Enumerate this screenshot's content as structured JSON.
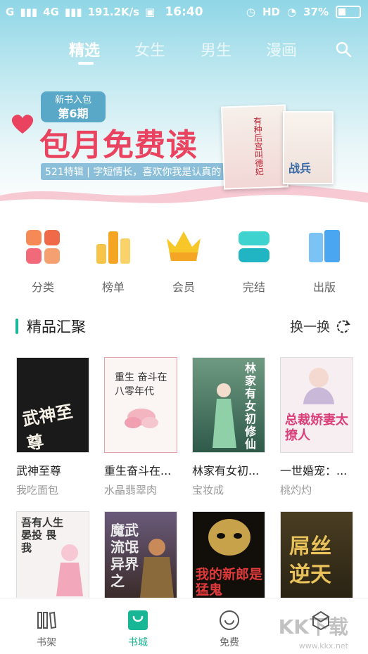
{
  "status_bar": {
    "signal_1": "G",
    "signal_2": "4G",
    "speed": "191.2K/s",
    "time": "16:40",
    "network": "HD",
    "battery": "37%"
  },
  "tabs": [
    {
      "label": "精选",
      "active": true
    },
    {
      "label": "女生",
      "active": false
    },
    {
      "label": "男生",
      "active": false
    },
    {
      "label": "漫画",
      "active": false
    }
  ],
  "banner": {
    "tag_line1": "新书入包",
    "tag_line2": "第6期",
    "title": "包月免费读",
    "subtitle": "521特辑 | 字短情长，喜欢你我是认真的",
    "book_a_text": "有种后宫叫德妃",
    "book_b_text": "战兵"
  },
  "categories": [
    {
      "label": "分类",
      "icon": "grid-icon",
      "color": "#f06a4a"
    },
    {
      "label": "榜单",
      "icon": "bar-chart-icon",
      "color": "#f5b12c"
    },
    {
      "label": "会员",
      "icon": "crown-icon",
      "color": "#f7c72a"
    },
    {
      "label": "完结",
      "icon": "stack-icon",
      "color": "#2dc6c4"
    },
    {
      "label": "出版",
      "icon": "book-icon",
      "color": "#4aa6f0"
    }
  ],
  "section": {
    "title": "精品汇聚",
    "refresh_label": "换一换"
  },
  "books_row1": [
    {
      "title": "武神至尊",
      "author": "我吃面包",
      "cover_text": "武神至尊",
      "bg": "#1a1a1a"
    },
    {
      "title": "重生奋斗在...",
      "author": "水晶翡翠肉",
      "cover_text": "重生 奋斗在八零年代",
      "bg": "#fbf5f3"
    },
    {
      "title": "林家有女初...",
      "author": "宝妆成",
      "cover_text": "林家有女初修仙",
      "bg": "#2f5a4a"
    },
    {
      "title": "一世婚宠：...",
      "author": "桃灼灼",
      "cover_text": "总裁娇妻太撩人",
      "bg": "#f6eef1"
    }
  ],
  "books_row2": [
    {
      "cover_text": "吾有人生 晏投 畏我",
      "bg": "#f7f2f2"
    },
    {
      "cover_text": "魔武流氓 异界之",
      "bg": "#3a2c2a"
    },
    {
      "cover_text": "我的新郎是猛鬼",
      "bg": "#120e0a"
    },
    {
      "cover_text": "屌丝 逆天",
      "bg": "#2a2314"
    }
  ],
  "bottom_nav": [
    {
      "label": "书架",
      "icon": "shelf-icon",
      "active": false
    },
    {
      "label": "书城",
      "icon": "store-bag-icon",
      "active": true
    },
    {
      "label": "免费",
      "icon": "smile-icon",
      "active": false
    },
    {
      "label": "",
      "icon": "gift-icon",
      "active": false
    }
  ],
  "watermark": {
    "big": "KK下载",
    "small": "www.kkx.net"
  }
}
